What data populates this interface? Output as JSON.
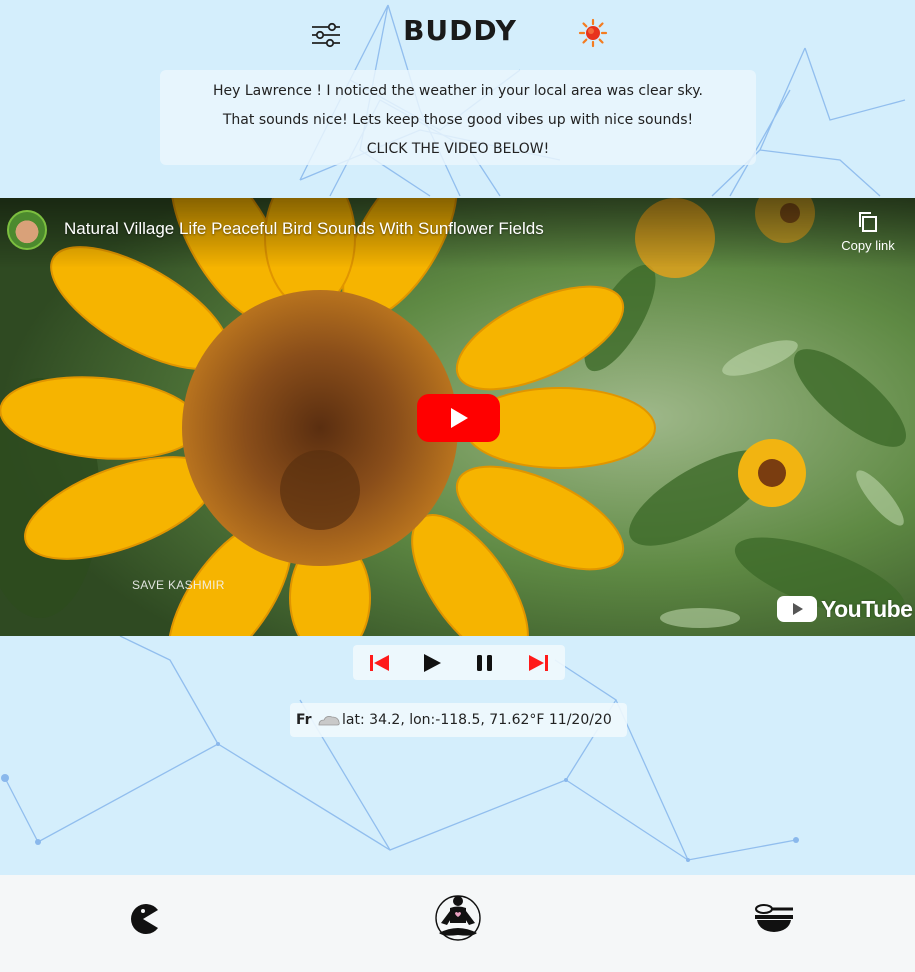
{
  "header": {
    "title": "BUDDY",
    "settings_icon": "sliders-icon",
    "weather_icon": "sun-icon"
  },
  "message": {
    "line1": "Hey Lawrence ! I noticed the weather in your local area was clear sky.",
    "line2": "That sounds nice! Lets keep those good vibes up with nice sounds!",
    "line3": "CLICK THE VIDEO BELOW!"
  },
  "video": {
    "title": "Natural Village Life Peaceful Bird Sounds With Sunflower Fields",
    "copy_link_label": "Copy link",
    "watermark": "SAVE KASHMIR",
    "platform": "YouTube",
    "accent": "#ff0000"
  },
  "controls": {
    "icons": [
      "skip-previous-icon",
      "play-icon",
      "pause-icon",
      "skip-next-icon"
    ]
  },
  "status": {
    "day": "Fr",
    "info": "lat: 34.2, lon:-118.5, 71.62°F 11/20/20",
    "icon": "cloud-icon"
  },
  "bottom_nav": {
    "items": [
      "pacman-icon",
      "meditation-icon",
      "bowl-whisk-icon"
    ]
  },
  "colors": {
    "background": "#d4eefc",
    "network_lines": "#8ab8ec",
    "control_red": "#ff1a1a"
  }
}
